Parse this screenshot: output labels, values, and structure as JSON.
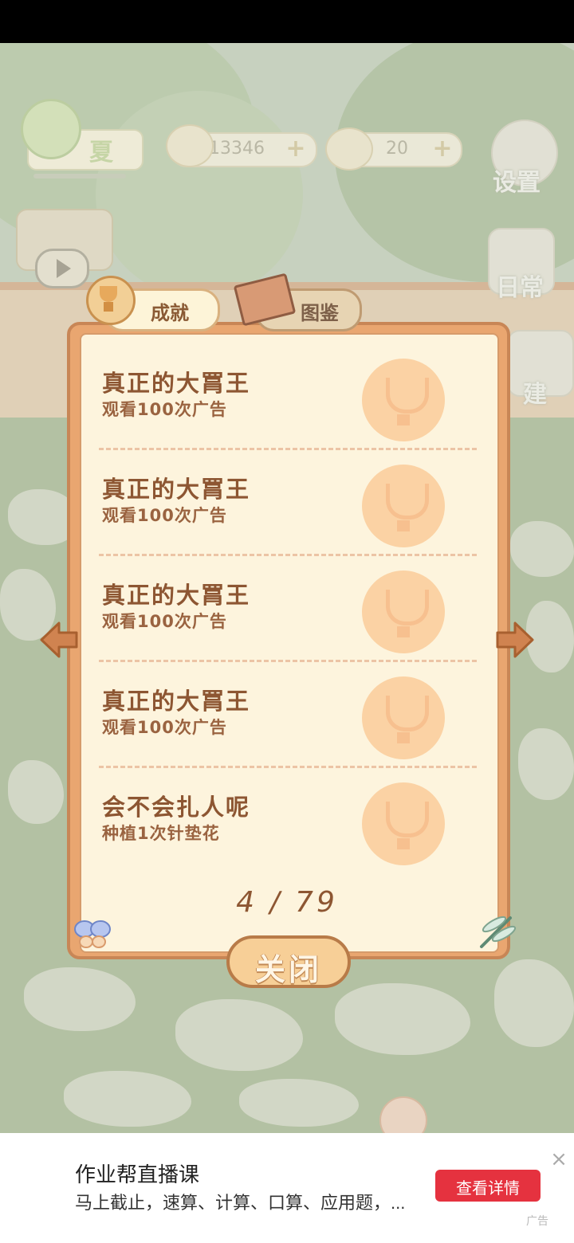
{
  "hud": {
    "season_label": "夏",
    "fish_count": "13346",
    "cheese_count": "20",
    "settings_label": "设置",
    "daily_label": "日常",
    "build_label": "建"
  },
  "tabs": {
    "achievements": "成就",
    "collection": "图鉴"
  },
  "achievements": [
    {
      "title": "真正的大罥王",
      "desc": "观看100次广告"
    },
    {
      "title": "真正的大罥王",
      "desc": "观看100次广告"
    },
    {
      "title": "真正的大罥王",
      "desc": "观看100次广告"
    },
    {
      "title": "真正的大罥王",
      "desc": "观看100次广告"
    },
    {
      "title": "会不会扎人呢",
      "desc": "种植1次针垫花"
    }
  ],
  "pagination": {
    "text": "4 / 79"
  },
  "close_label": "关闭",
  "ad": {
    "title": "作业帮直播课",
    "desc": "马上截止，速算、计算、口算、应用题，...",
    "button": "查看详情",
    "close": "×",
    "tag": "广告"
  }
}
